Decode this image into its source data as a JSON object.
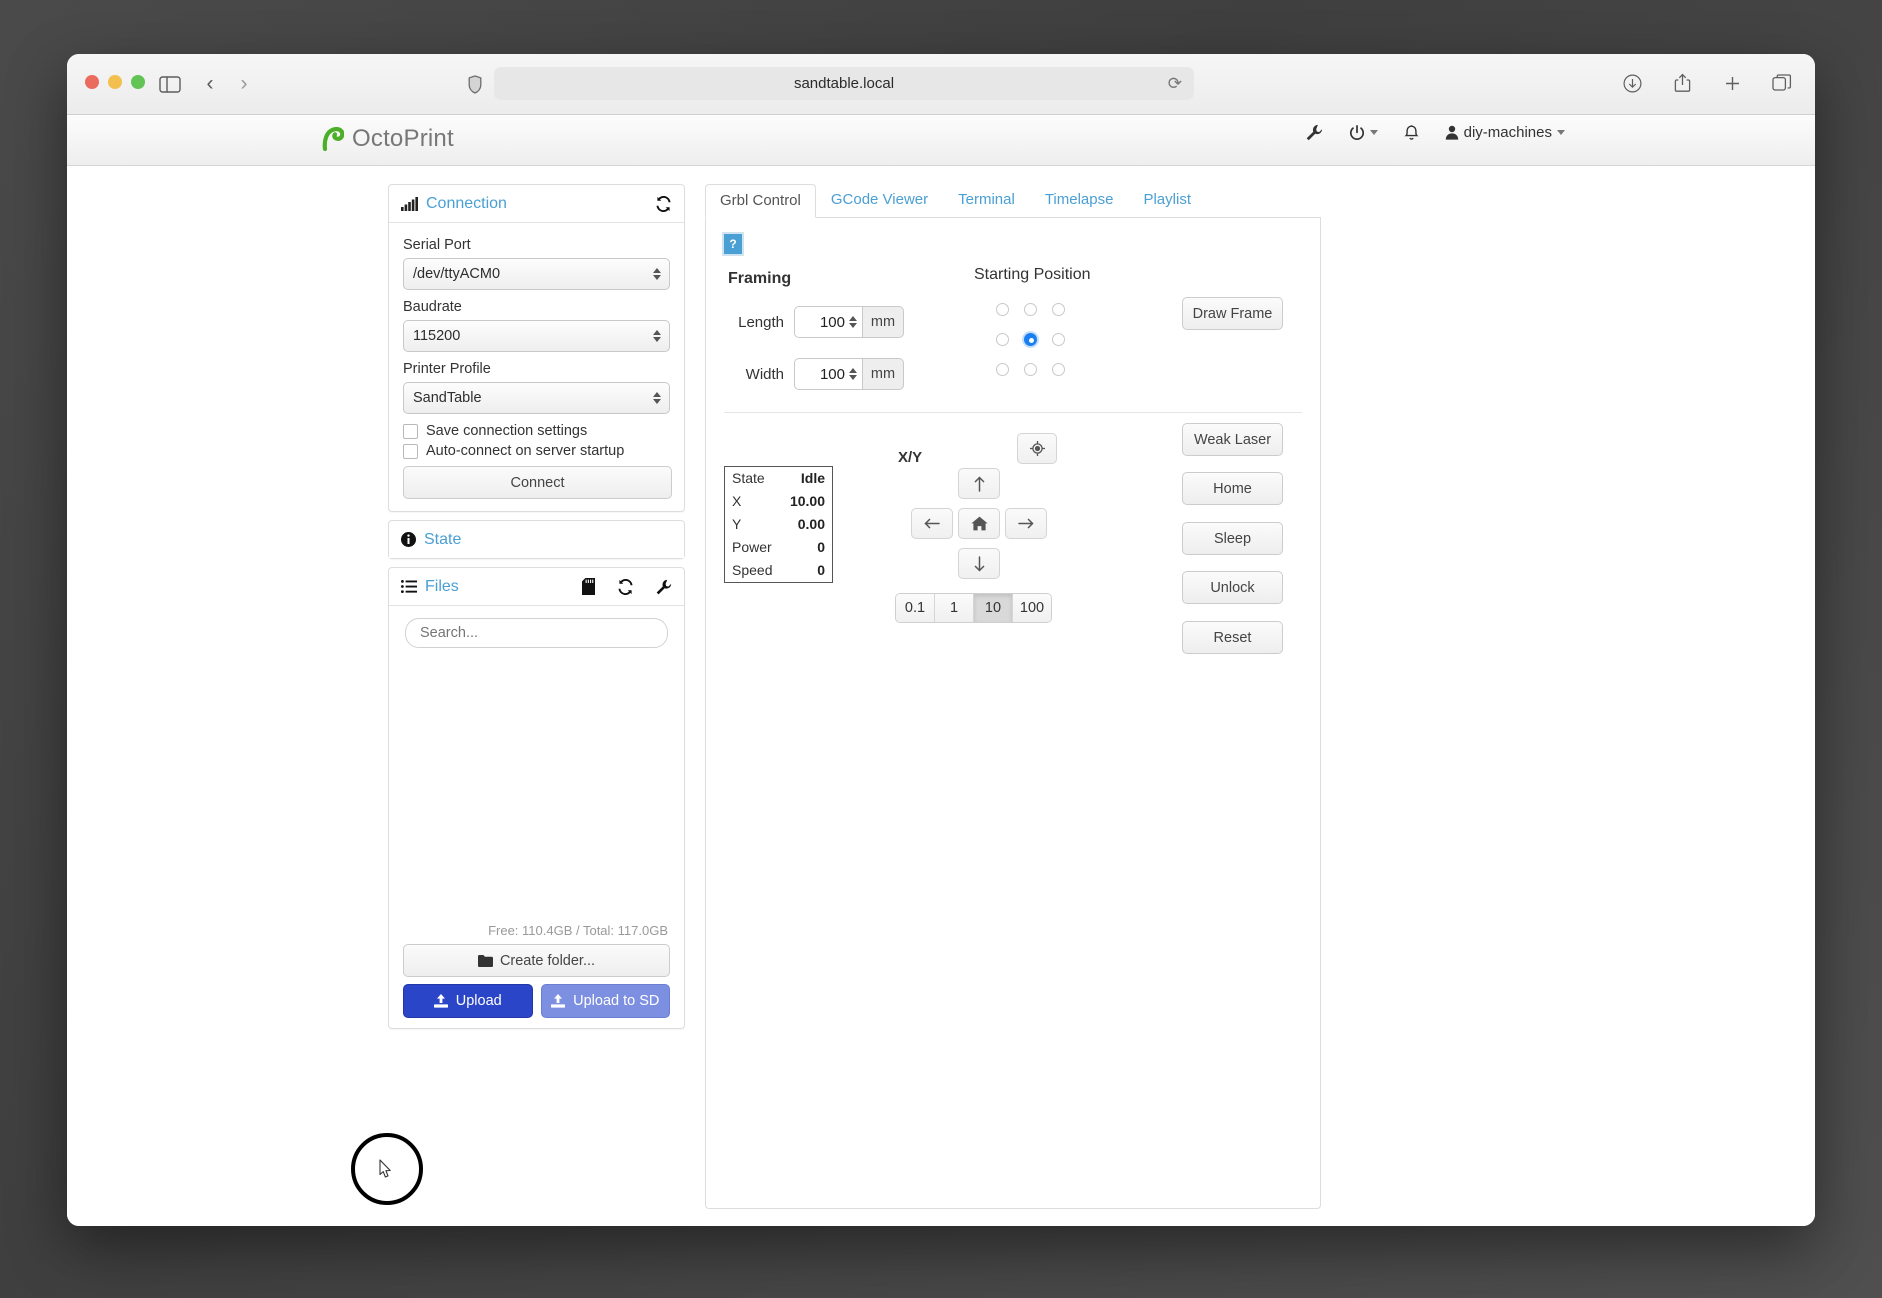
{
  "browser": {
    "url": "sandtable.local",
    "icons": {
      "sidebar": "sidebar-toggle-icon",
      "back": "back-chevron-icon",
      "forward": "forward-chevron-icon",
      "shield": "privacy-shield-icon",
      "reload": "reload-icon",
      "download": "download-icon",
      "share": "share-icon",
      "newtab": "new-tab-icon",
      "tabs": "tab-overview-icon"
    }
  },
  "app": {
    "brand": "OctoPrint",
    "nav": {
      "wrench_icon": "wrench-icon",
      "power_icon": "power-icon",
      "bell_icon": "bell-icon",
      "user": "diy-machines"
    }
  },
  "connection": {
    "title": "Connection",
    "refresh_icon": "refresh-icon",
    "signal_icon": "signal-bars-icon",
    "serial_port_label": "Serial Port",
    "serial_port_value": "/dev/ttyACM0",
    "baudrate_label": "Baudrate",
    "baudrate_value": "115200",
    "printer_profile_label": "Printer Profile",
    "printer_profile_value": "SandTable",
    "save_settings_label": "Save connection settings",
    "autoconnect_label": "Auto-connect on server startup",
    "connect_label": "Connect"
  },
  "state_panel": {
    "title": "State",
    "info_icon": "info-circle-icon"
  },
  "files": {
    "title": "Files",
    "list_icon": "list-icon",
    "sd_icon": "sd-card-icon",
    "refresh_icon": "refresh-icon",
    "wrench_icon": "wrench-icon",
    "search_placeholder": "Search...",
    "storage": "Free: 110.4GB / Total: 117.0GB",
    "create_folder_label": "Create folder...",
    "folder_icon": "folder-icon",
    "upload_label": "Upload",
    "upload_sd_label": "Upload to SD",
    "upload_icon": "upload-icon"
  },
  "tabs": [
    {
      "label": "Grbl Control",
      "active": true
    },
    {
      "label": "GCode Viewer",
      "active": false
    },
    {
      "label": "Terminal",
      "active": false
    },
    {
      "label": "Timelapse",
      "active": false
    },
    {
      "label": "Playlist",
      "active": false
    }
  ],
  "grbl": {
    "help_label": "?",
    "framing_title": "Framing",
    "length_label": "Length",
    "length_value": "100",
    "length_unit": "mm",
    "width_label": "Width",
    "width_value": "100",
    "width_unit": "mm",
    "starting_position_title": "Starting Position",
    "starting_position_selected_index": 4,
    "draw_frame_label": "Draw Frame",
    "side_buttons": [
      "Weak Laser",
      "Home",
      "Sleep",
      "Unlock",
      "Reset"
    ],
    "status": {
      "rows": [
        {
          "key": "State",
          "value": "Idle"
        },
        {
          "key": "X",
          "value": "10.00"
        },
        {
          "key": "Y",
          "value": "0.00"
        },
        {
          "key": "Power",
          "value": "0"
        },
        {
          "key": "Speed",
          "value": "0"
        }
      ]
    },
    "xy_label": "X/Y",
    "jog": {
      "up_icon": "arrow-up-icon",
      "left_icon": "arrow-left-icon",
      "home_icon": "home-icon",
      "right_icon": "arrow-right-icon",
      "down_icon": "arrow-down-icon",
      "target_icon": "crosshair-icon"
    },
    "step_sizes": [
      "0.1",
      "1",
      "10",
      "100"
    ],
    "step_selected": "10"
  },
  "colors": {
    "link": "#4a9fd4",
    "primary": "#2a45c8",
    "secondary": "#7d8fe0",
    "accent_radio": "#1a7ff2",
    "logo_green": "#4caf28"
  }
}
